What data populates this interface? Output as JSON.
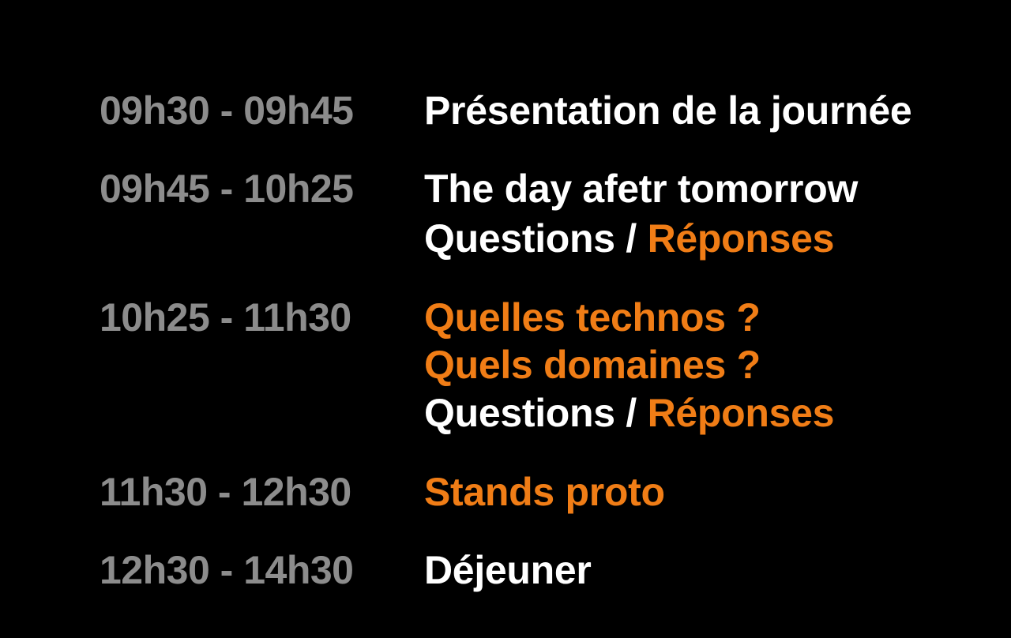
{
  "colors": {
    "background": "#000000",
    "time": "#8c8c8c",
    "text": "#ffffff",
    "accent": "#f07d16"
  },
  "schedule": [
    {
      "time": "09h30 - 09h45",
      "lines": [
        [
          {
            "text": "Présentation de la journée",
            "style": "text"
          }
        ]
      ]
    },
    {
      "time": "09h45 - 10h25",
      "lines": [
        [
          {
            "text": "The day afetr tomorrow",
            "style": "text"
          }
        ],
        [
          {
            "text": "Questions / ",
            "style": "text"
          },
          {
            "text": "Réponses",
            "style": "accent"
          }
        ]
      ]
    },
    {
      "time": "10h25 - 11h30",
      "lines": [
        [
          {
            "text": "Quelles technos ?",
            "style": "accent"
          }
        ],
        [
          {
            "text": "Quels domaines ?",
            "style": "accent"
          }
        ],
        [
          {
            "text": "Questions / ",
            "style": "text"
          },
          {
            "text": "Réponses",
            "style": "accent"
          }
        ]
      ]
    },
    {
      "time": "11h30 - 12h30",
      "lines": [
        [
          {
            "text": "Stands proto",
            "style": "accent"
          }
        ]
      ]
    },
    {
      "time": "12h30 - 14h30",
      "lines": [
        [
          {
            "text": "Déjeuner",
            "style": "text"
          }
        ]
      ]
    }
  ]
}
